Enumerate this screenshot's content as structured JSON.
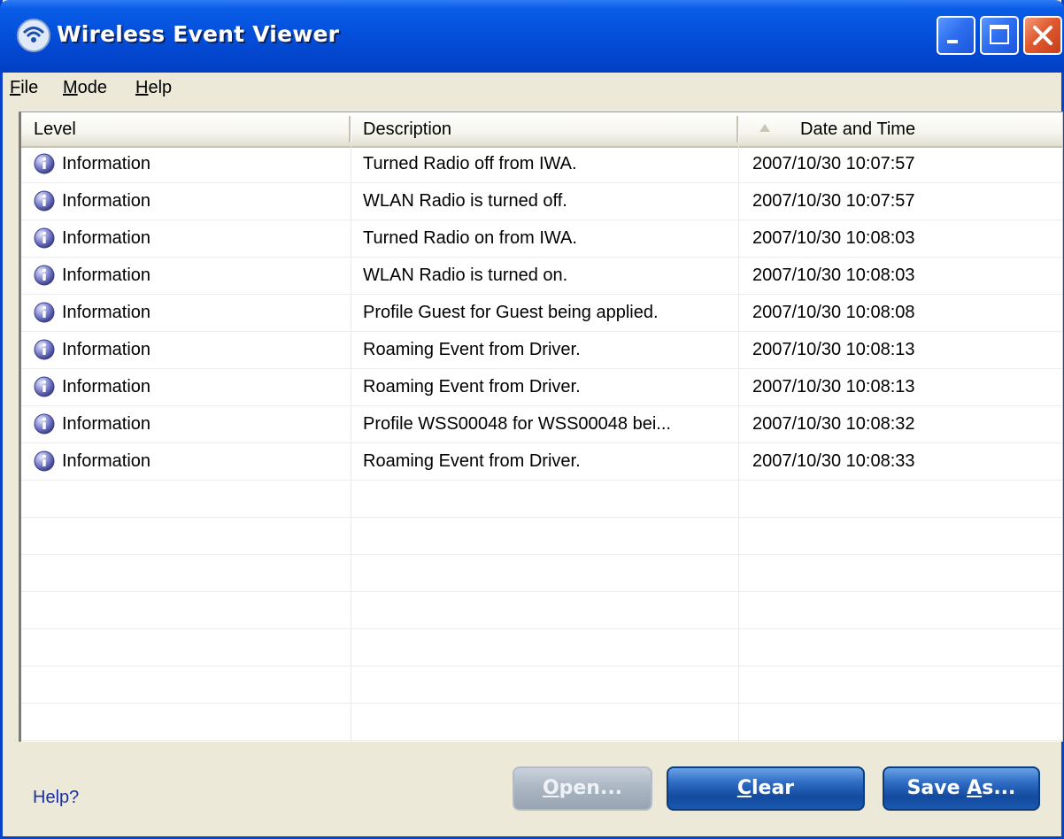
{
  "window": {
    "title": "Wireless Event Viewer",
    "icon": "wireless-icon"
  },
  "menu": [
    {
      "mnemonic": "F",
      "rest": "ile"
    },
    {
      "mnemonic": "M",
      "rest": "ode"
    },
    {
      "mnemonic": "H",
      "rest": "elp"
    }
  ],
  "table": {
    "columns": [
      "Level",
      "Description",
      "Date and Time"
    ],
    "sort_column": "Date and Time",
    "sort_direction": "ascending",
    "rows": [
      {
        "level": "Information",
        "description": "Turned Radio off from IWA.",
        "datetime": "2007/10/30 10:07:57"
      },
      {
        "level": "Information",
        "description": "WLAN Radio is turned off.",
        "datetime": "2007/10/30 10:07:57"
      },
      {
        "level": "Information",
        "description": "Turned Radio on from IWA.",
        "datetime": "2007/10/30 10:08:03"
      },
      {
        "level": "Information",
        "description": "WLAN Radio is turned on.",
        "datetime": "2007/10/30 10:08:03"
      },
      {
        "level": "Information",
        "description": "Profile Guest for Guest being applied.",
        "datetime": "2007/10/30 10:08:08"
      },
      {
        "level": "Information",
        "description": "Roaming Event from Driver.",
        "datetime": "2007/10/30 10:08:13"
      },
      {
        "level": "Information",
        "description": "Roaming Event from Driver.",
        "datetime": "2007/10/30 10:08:13"
      },
      {
        "level": "Information",
        "description": "Profile WSS00048 for WSS00048 bei...",
        "datetime": "2007/10/30 10:08:32"
      },
      {
        "level": "Information",
        "description": "Roaming Event from Driver.",
        "datetime": "2007/10/30 10:08:33"
      }
    ]
  },
  "footer": {
    "help_link": "Help?",
    "open_button": {
      "mnemonic": "O",
      "rest": "pen...",
      "enabled": false
    },
    "clear_button": {
      "mnemonic": "C",
      "rest": "lear",
      "enabled": true
    },
    "save_button": {
      "before": "Save ",
      "mnemonic": "A",
      "rest": "s...",
      "enabled": true
    }
  },
  "colors": {
    "titlebar": "#0450db",
    "close_button": "#e05a30",
    "link": "#1a2fa8",
    "info_icon": "#5a5fb0"
  }
}
